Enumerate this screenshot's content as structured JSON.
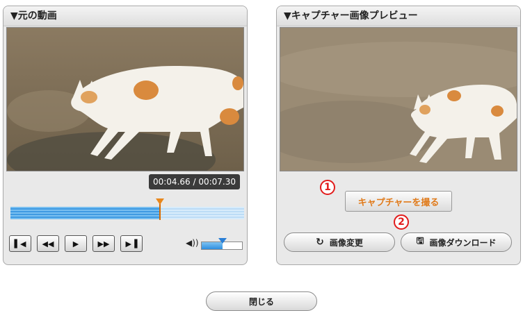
{
  "left_panel": {
    "title": "▼元の動画",
    "timecode": "00:04.66 / 00:07.30",
    "seek_progress": 0.64,
    "volume_level": 0.5,
    "controls": {
      "skip_start": "skip-to-start-icon",
      "rewind": "rewind-icon",
      "play": "play-icon",
      "fast_forward": "fast-forward-icon",
      "skip_end": "skip-to-end-icon"
    }
  },
  "right_panel": {
    "title": "▼キャプチャー画像プレビュー",
    "capture_button": "キャプチャーを撮る",
    "change_image_button": "画像変更",
    "download_button": "画像ダウンロード",
    "marker_1": "1",
    "marker_2": "2"
  },
  "close_button": "閉じる",
  "colors": {
    "accent_orange": "#e07a1a",
    "marker_red": "#e21b1b",
    "seek_blue": "#3f9ae2"
  }
}
